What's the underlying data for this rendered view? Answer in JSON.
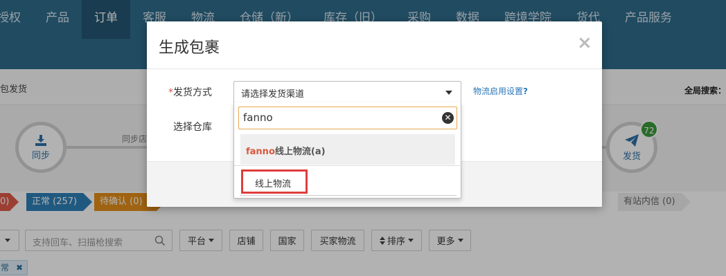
{
  "topnav": {
    "items": [
      "授权",
      "产品",
      "订单",
      "客服",
      "物流",
      "仓储（新）",
      "库存（旧）",
      "采购",
      "数据",
      "跨境学院",
      "货代",
      "产品服务"
    ],
    "active_index": 2
  },
  "subbar": {
    "left_text": "包发货",
    "right_text": "全局搜索："
  },
  "steps": {
    "sync_label": "同步",
    "sync_caption": "同步店",
    "ship_label": "发货",
    "ship_badge": "72"
  },
  "status_tags": {
    "red": "0)",
    "normal": "正常 (257)",
    "pending": "待确认 (0)",
    "station": "有站内信 (0)"
  },
  "filters": {
    "search_placeholder": "支持回车、扫描枪搜索",
    "platform": "平台",
    "shop": "店铺",
    "country": "国家",
    "buyer_logistics": "买家物流",
    "sort": "排序",
    "more": "更多"
  },
  "chip": {
    "label": "常",
    "remove": "✖"
  },
  "modal": {
    "title": "生成包裹",
    "close": "×",
    "ship_method_required": "*",
    "ship_method_label": "发货方式",
    "warehouse_label": "选择仓库",
    "select_value": "请选择发货渠道",
    "help_link": "物流启用设置",
    "help_mark": "?",
    "dropdown": {
      "search_value": "fanno",
      "group_highlight": "fanno",
      "group_rest": "线上物流(a)",
      "option": "线上物流"
    }
  },
  "colors": {
    "nav_bg": "#2f6c8c",
    "accent_blue": "#2f80b8",
    "warn_orange": "#e48f1a",
    "error_red": "#e03c3c",
    "badge_green": "#3c9a3c"
  }
}
